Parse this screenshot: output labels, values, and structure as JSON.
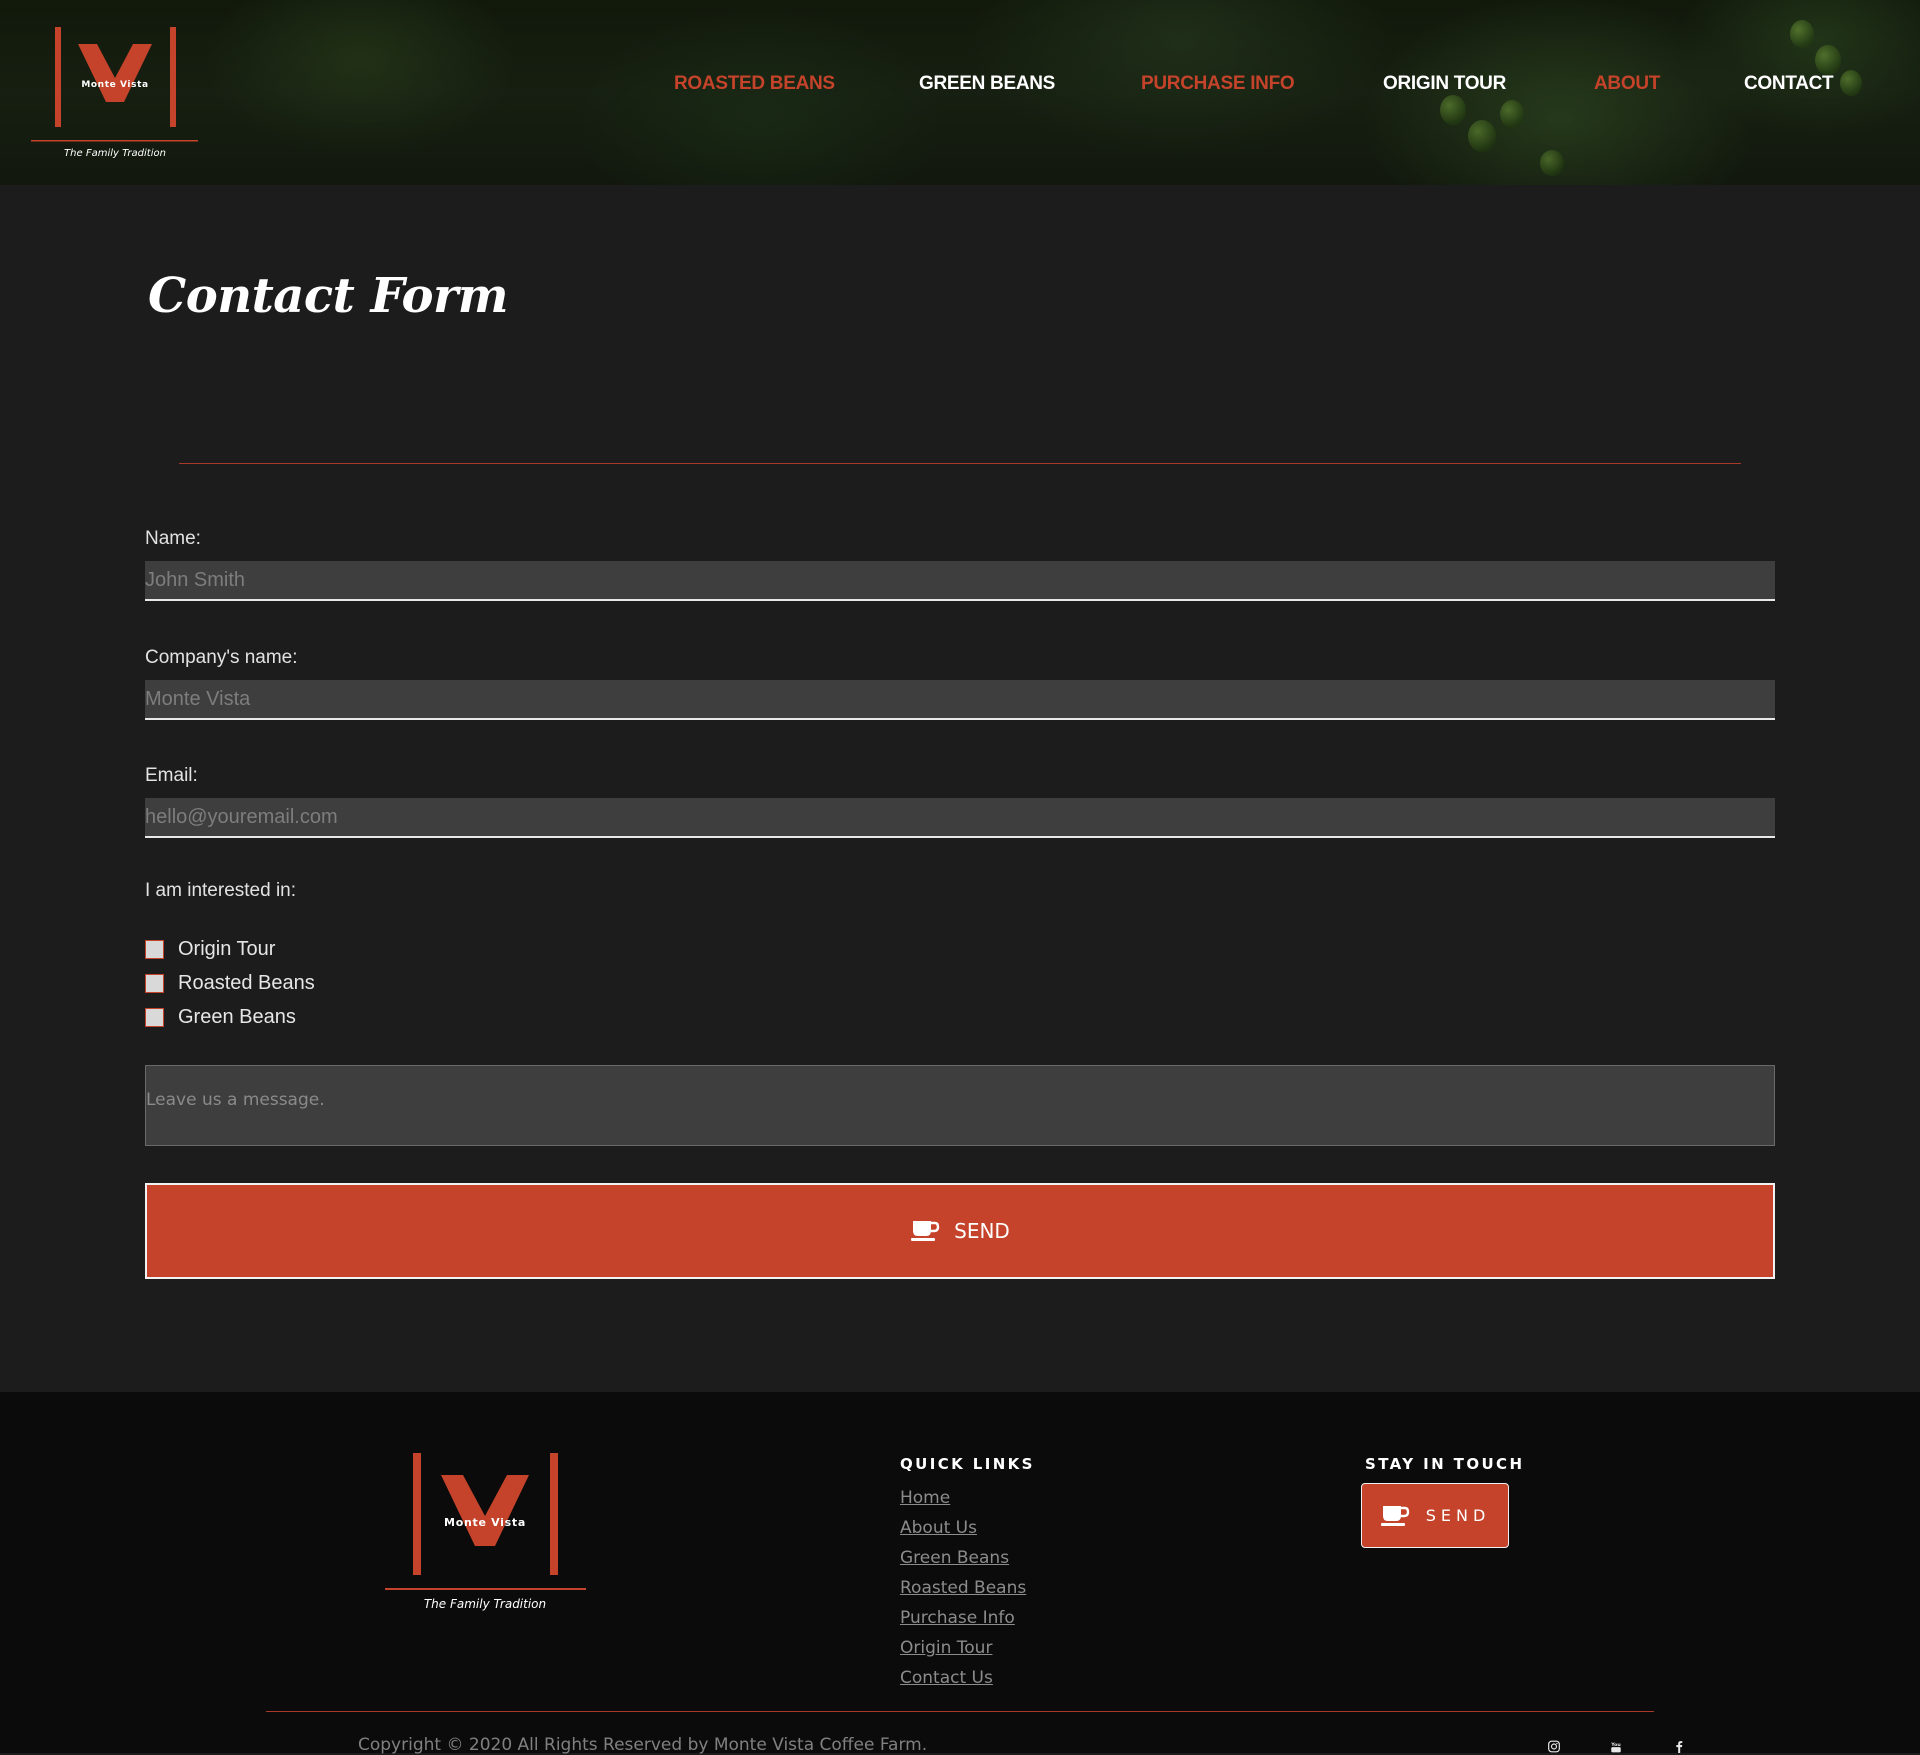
{
  "brand": {
    "name": "Monte Vista",
    "tagline": "The Family Tradition",
    "accent_color": "#c4432a"
  },
  "nav": {
    "items": [
      {
        "label": "ROASTED BEANS",
        "color": "red"
      },
      {
        "label": "GREEN BEANS",
        "color": "white"
      },
      {
        "label": "PURCHASE INFO",
        "color": "red"
      },
      {
        "label": "ORIGIN TOUR",
        "color": "white"
      },
      {
        "label": "ABOUT",
        "color": "red"
      },
      {
        "label": "CONTACT",
        "color": "white"
      }
    ]
  },
  "form": {
    "title": "Contact Form",
    "name_label": "Name:",
    "name_placeholder": "John Smith",
    "company_label": "Company's name:",
    "company_placeholder": "Monte Vista",
    "email_label": "Email:",
    "email_placeholder": "hello@youremail.com",
    "interest_label": "I am interested in:",
    "interests": [
      {
        "label": "Origin Tour",
        "checked": false
      },
      {
        "label": "Roasted Beans",
        "checked": false
      },
      {
        "label": "Green Beans",
        "checked": false
      }
    ],
    "message_placeholder": "Leave us a message.",
    "send_label": "SEND",
    "send_icon": "coffee-cup-icon"
  },
  "footer": {
    "quick_links_title": "QUICK LINKS",
    "quick_links": [
      "Home",
      "About Us",
      "Green Beans",
      "Roasted Beans",
      "Purchase Info",
      "Origin Tour",
      "Contact Us"
    ],
    "stay_title": "STAY IN TOUCH",
    "send_label": "SEND",
    "copyright": "Copyright © 2020 All Rights Reserved by Monte Vista Coffee Farm.",
    "social_icons": [
      "instagram-icon",
      "youtube-icon",
      "facebook-icon"
    ]
  }
}
